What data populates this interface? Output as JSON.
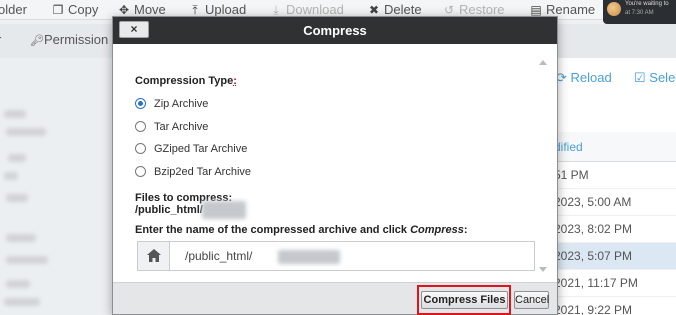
{
  "toolbar": {
    "items": [
      {
        "label": "older",
        "icon": "folder-icon"
      },
      {
        "label": "Copy",
        "icon": "copy-icon"
      },
      {
        "label": "Move",
        "icon": "move-icon"
      },
      {
        "label": "Upload",
        "icon": "upload-icon"
      },
      {
        "label": "Download",
        "icon": "download-icon"
      },
      {
        "label": "Delete",
        "icon": "delete-icon"
      },
      {
        "label": "Restore",
        "icon": "restore-icon"
      },
      {
        "label": "Rename",
        "icon": "rename-icon"
      }
    ],
    "permissions_label": "Permission",
    "settings_label": "r"
  },
  "notification": {
    "line1": "You're waiting to",
    "line2": "at 7:30 AM"
  },
  "right_pane": {
    "reload_label": "Reload",
    "select_label": "Selec",
    "column_header": "dified",
    "rows": [
      "51 PM",
      "2023, 5:00 AM",
      "2023, 8:02 PM",
      "2023, 5:07 PM",
      "2021, 11:17 PM",
      "2021, 9:22 PM"
    ]
  },
  "modal": {
    "title": "Compress",
    "close_label": "×",
    "compression_type_label": "Compression Type",
    "compression_type_suffix": ":",
    "options": [
      {
        "label": "Zip Archive",
        "checked": true
      },
      {
        "label": "Tar Archive",
        "checked": false
      },
      {
        "label": "GZiped Tar Archive",
        "checked": false
      },
      {
        "label": "Bzip2ed Tar Archive",
        "checked": false
      }
    ],
    "files_to_compress_label": "Files to compress:",
    "files_path": "/public_html/",
    "archive_instruction_prefix": "Enter the name of the compressed archive and click ",
    "archive_instruction_emphasis": "Compress",
    "archive_instruction_suffix": ":",
    "archive_path_value": "/public_html/",
    "compress_button": "Compress Files",
    "cancel_button": "Cancel"
  },
  "colors": {
    "header_bg": "#2f3133",
    "accent_blue": "#2a72c4",
    "link_blue": "#4a9fd8",
    "highlight_red": "#e0141a"
  }
}
